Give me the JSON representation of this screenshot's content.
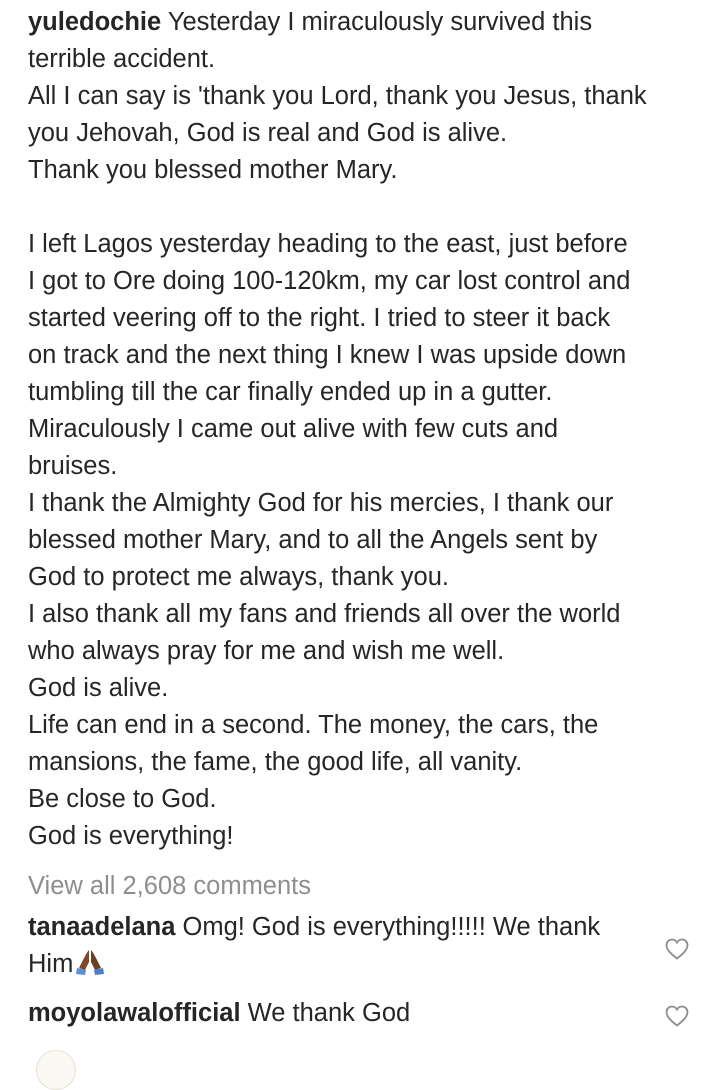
{
  "post": {
    "username": "yuledochie",
    "caption_lines": [
      "Yesterday I miraculously survived this",
      "terrible accident.",
      "All I can say is 'thank you Lord, thank you Jesus, thank",
      "you Jehovah, God is real and God is alive.",
      "Thank you blessed mother Mary.",
      "",
      "I left Lagos yesterday heading to the east, just before",
      "I got to Ore doing 100-120km, my car lost control and",
      "started veering off to the right. I tried to steer it back",
      "on track and the next thing I knew I was upside down",
      "tumbling till the car finally ended up in a gutter.",
      "Miraculously I came out alive with few cuts and",
      "bruises.",
      "I thank the Almighty God for his mercies, I thank our",
      "blessed mother Mary, and to all the Angels sent by",
      "God to protect me always, thank you.",
      "I also thank all my fans and friends all over the world",
      "who always pray for me and wish me well.",
      "God is alive.",
      "Life can end in a second. The money, the cars, the",
      "mansions, the fame, the good life, all vanity.",
      "Be close to God.",
      "God is everything!"
    ]
  },
  "view_all_comments": "View all 2,608 comments",
  "comments": [
    {
      "username": "tanaadelana",
      "text_line1": "Omg! God is everything!!!!! We thank",
      "text_line2": "Him",
      "emoji": "folded-hands-icon"
    },
    {
      "username": "moyolawalofficial",
      "text_line1": "We thank God"
    }
  ],
  "colors": {
    "text": "#262626",
    "muted": "#8e8e8e",
    "heart_outline": "#8e8e8e",
    "emoji_skin": "#7a4a2a",
    "emoji_sleeve": "#5b8fd6"
  }
}
